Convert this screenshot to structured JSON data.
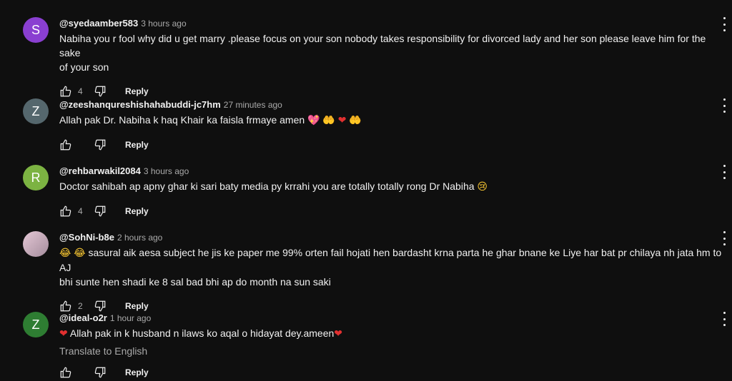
{
  "comments": [
    {
      "handle": "@syedaamber583",
      "time": "3 hours ago",
      "avatar_letter": "S",
      "avatar_color": "#8a3fd1",
      "lines": [
        "Nabiha you r fool why did u get marry .please  focus on your son nobody takes responsibility  for divorced  lady and her son please  leave him for the sake",
        "of your  son"
      ],
      "likes": "4",
      "reply_label": "Reply"
    },
    {
      "handle": "@zeeshanqureshishahabuddi-jc7hm",
      "time": "27 minutes ago",
      "avatar_letter": "Z",
      "avatar_color": "#55676d",
      "text_before": "Allah pak Dr. Nabiha k haq Khair ka    faisla frmaye amen ",
      "emojis": [
        "💖",
        "🤲",
        "❤",
        "🤲"
      ],
      "likes": "",
      "reply_label": "Reply"
    },
    {
      "handle": "@rehbarwakil2084",
      "time": "3 hours ago",
      "avatar_letter": "R",
      "avatar_color": "#7cb342",
      "text_before": "Doctor sahibah ap apny ghar ki sari baty media py krrahi you are totally totally rong Dr Nabiha ",
      "emojis": [
        "😢"
      ],
      "likes": "4",
      "reply_label": "Reply"
    },
    {
      "handle": "@SohNi-b8e",
      "time": "2 hours ago",
      "avatar_letter": "",
      "avatar_color": "#c9a7b8",
      "emojis_lead": [
        "😂",
        "😂"
      ],
      "lines": [
        " sasural aik aesa subject he jis ke paper me 99% orten fail hojati hen bardasht krna parta he ghar bnane ke Liye har bat pr chilaya nh jata hm to AJ",
        "bhi sunte hen shadi ke 8 sal bad bhi ap do month na sun saki"
      ],
      "likes": "2",
      "reply_label": "Reply"
    },
    {
      "handle": "@ideal-o2r",
      "time": "1 hour ago",
      "avatar_letter": "Z",
      "avatar_color": "#2e7d32",
      "text_before": "Allah pak in k husband n ilaws ko aqal o hidayat dey.ameen",
      "heart": "❤",
      "translate_label": "Translate to English",
      "likes": "",
      "reply_label": "Reply"
    }
  ],
  "icons": {
    "like": "thumb-up-icon",
    "dislike": "thumb-down-icon",
    "more": "more-vert-icon"
  }
}
